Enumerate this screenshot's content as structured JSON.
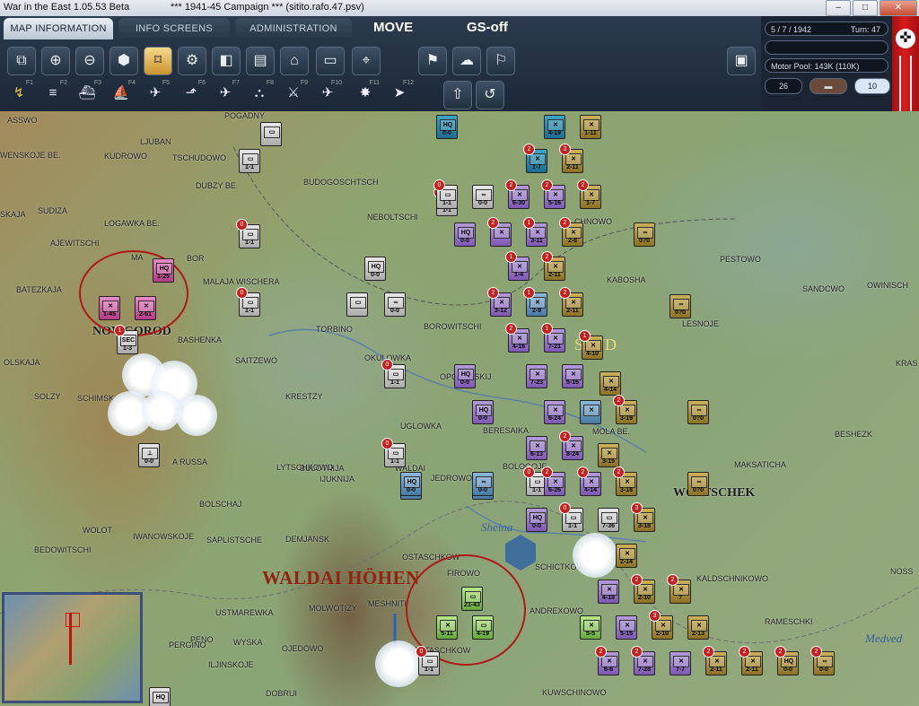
{
  "window": {
    "title": "War in the East 1.05.53 Beta",
    "subtitle": "***   1941-45 Campaign   ***   (sitito.rafo.47.psv)",
    "minimize": "‒",
    "maximize": "□",
    "close": "✕"
  },
  "tabs": [
    {
      "label": "MAP INFORMATION",
      "active": true
    },
    {
      "label": "INFO SCREENS",
      "active": false
    },
    {
      "label": "ADMINISTRATION",
      "active": false
    }
  ],
  "modes": {
    "move": "MOVE",
    "gs": "GS-off"
  },
  "info": {
    "date": "5 / 7 / 1942",
    "turn": "Turn: 47",
    "motor_pool": "Motor Pool:  143K (110K)",
    "count": "26",
    "value": "10"
  },
  "toolbar_row1": [
    {
      "icon": "windows-icon",
      "glyph": "⧉"
    },
    {
      "icon": "zoom-in-icon",
      "glyph": "⊕"
    },
    {
      "icon": "zoom-out-icon",
      "glyph": "⊖"
    },
    {
      "icon": "hex-grid-icon",
      "glyph": "⬢"
    },
    {
      "icon": "unit-frame-icon",
      "glyph": "⌑",
      "selected": true
    },
    {
      "icon": "gear-icon",
      "glyph": "⚙"
    },
    {
      "icon": "unit-display-icon",
      "glyph": "◧"
    },
    {
      "icon": "hq-icon",
      "glyph": "▤"
    },
    {
      "icon": "factory-icon",
      "glyph": "⌂"
    },
    {
      "icon": "rectangle-icon",
      "glyph": "▭"
    },
    {
      "icon": "fortification-icon",
      "glyph": "⌖"
    },
    {
      "icon": "flag-signal-icon",
      "glyph": "⚑"
    },
    {
      "icon": "weather-icon",
      "glyph": "☁"
    },
    {
      "icon": "flag-icon",
      "glyph": "⚐"
    },
    {
      "icon": "panel-icon",
      "glyph": "▣"
    }
  ],
  "toolbar_row2": [
    {
      "icon": "move-mode-icon",
      "glyph": "↯",
      "key": "F1",
      "selected": true
    },
    {
      "icon": "rail-icon",
      "glyph": "≡",
      "key": "F2"
    },
    {
      "icon": "naval-icon",
      "glyph": "⛴",
      "key": "F3"
    },
    {
      "icon": "ship-icon",
      "glyph": "⛵",
      "key": "F4"
    },
    {
      "icon": "air-recon-icon",
      "glyph": "✈",
      "key": "F5"
    },
    {
      "icon": "air-supply-icon",
      "glyph": "⬏",
      "key": "F6"
    },
    {
      "icon": "air-transport-icon",
      "glyph": "✈",
      "key": "F7"
    },
    {
      "icon": "airbase-icon",
      "glyph": "⛬",
      "key": "F8"
    },
    {
      "icon": "paradrop-icon",
      "glyph": "⚔",
      "key": "F9"
    },
    {
      "icon": "air-attack-icon",
      "glyph": "✈",
      "key": "F10"
    },
    {
      "icon": "bombing-icon",
      "glyph": "✸",
      "key": "F11"
    },
    {
      "icon": "compass-icon",
      "glyph": "➤",
      "key": "F12"
    },
    {
      "icon": "upload-icon",
      "glyph": "⇧"
    },
    {
      "icon": "undo-icon",
      "glyph": "↺"
    }
  ],
  "map_labels": [
    {
      "text": "ASSWO"
    },
    {
      "text": "POGADNY"
    },
    {
      "text": "LJUBAN"
    },
    {
      "text": "WENSKOJE BE."
    },
    {
      "text": "KUDROWO"
    },
    {
      "text": "TSCHUDOWO"
    },
    {
      "text": "BUDOGOSCHTSCH"
    },
    {
      "text": "SKAJA"
    },
    {
      "text": "SUDIZA"
    },
    {
      "text": "DUBZY BE"
    },
    {
      "text": "NEBOLTSCHI"
    },
    {
      "text": "CHNOWO"
    },
    {
      "text": "LOGAWKA BE."
    },
    {
      "text": "AJEWITSCHI"
    },
    {
      "text": "MA"
    },
    {
      "text": "BOR"
    },
    {
      "text": "PESTOWO"
    },
    {
      "text": "BATEZKAJA"
    },
    {
      "text": "MALAJA WISCHERA"
    },
    {
      "text": "KABOSHA"
    },
    {
      "text": "SANDCWO"
    },
    {
      "text": "OWINISCH"
    },
    {
      "text": "LESNOJE"
    },
    {
      "text": "NOWGOROD"
    },
    {
      "text": "BASHENKA"
    },
    {
      "text": "TORBINO"
    },
    {
      "text": "BOROWITSCHI"
    },
    {
      "text": "OLSKAJA"
    },
    {
      "text": "SAITZEWO"
    },
    {
      "text": "OKULOWKA"
    },
    {
      "text": "KRAS"
    },
    {
      "text": "SOLZY"
    },
    {
      "text": "SCHIMSK"
    },
    {
      "text": "KRESTZY"
    },
    {
      "text": "OPCHENSKIJ"
    },
    {
      "text": "UGLOWKA"
    },
    {
      "text": "BERESAIKA"
    },
    {
      "text": "MOLA BE."
    },
    {
      "text": "BESHEZK"
    },
    {
      "text": "BULOTNIJA"
    },
    {
      "text": "BOLOGOJE"
    },
    {
      "text": "MAKSATICHA"
    },
    {
      "text": "LYTSCHKOWO"
    },
    {
      "text": "WALDAI"
    },
    {
      "text": "JEDROWO"
    },
    {
      "text": "WOLTSCHEK"
    },
    {
      "text": "A RUSSA"
    },
    {
      "text": "IJUKNIJA"
    },
    {
      "text": "OSTASCHKOW"
    },
    {
      "text": "BOLSCHAJ"
    },
    {
      "text": "WOLOT"
    },
    {
      "text": "IWANOWSKOJE"
    },
    {
      "text": "SAPLISTSCHE"
    },
    {
      "text": "DEMJANSK"
    },
    {
      "text": "SCHICTKOWO"
    },
    {
      "text": "BEDOWITSCHI"
    },
    {
      "text": "FIROWO"
    },
    {
      "text": "KALDSCHNIKOWO"
    },
    {
      "text": "NOSS"
    },
    {
      "text": "MESHNITI"
    },
    {
      "text": "USTMAREWKA"
    },
    {
      "text": "MOLWOTIZY"
    },
    {
      "text": "ANDREXOWO"
    },
    {
      "text": "RAMESCHKI"
    },
    {
      "text": "PENO"
    },
    {
      "text": "WYSKA"
    },
    {
      "text": "OSTASCHKOW"
    },
    {
      "text": "PERGINO"
    },
    {
      "text": "OJEDOWO"
    },
    {
      "text": "ILJINSKOJE"
    },
    {
      "text": "KUWSCHINOWO"
    },
    {
      "text": "DOBRUI"
    }
  ],
  "region_label": "WALDAI HÖHEN",
  "river_label": "Sheina",
  "river_label2": "Medved",
  "faded_label": "SEND",
  "units": [
    {
      "c": "u-pink",
      "s": "HQ",
      "v": "1-25",
      "b": ""
    },
    {
      "c": "u-pink",
      "s": "✕",
      "v": "1-45",
      "b": ""
    },
    {
      "c": "u-pink",
      "s": "✕",
      "v": "2-61",
      "b": ""
    },
    {
      "c": "u-gray",
      "s": "SEC",
      "v": "1-3",
      "b": "1"
    },
    {
      "c": "u-gray",
      "s": "▭",
      "v": "",
      "b": ""
    },
    {
      "c": "u-gray",
      "s": "▭",
      "v": "1-1",
      "b": ""
    },
    {
      "c": "u-gray",
      "s": "▭",
      "v": "1-1",
      "b": "0"
    },
    {
      "c": "u-gray",
      "s": "HQ",
      "v": "0-0",
      "b": ""
    },
    {
      "c": "u-gray",
      "s": "▭",
      "v": "1-1",
      "b": "0"
    },
    {
      "c": "u-gray",
      "s": "▭",
      "v": "",
      "b": ""
    },
    {
      "c": "u-gray",
      "s": "∞",
      "v": "0-0",
      "b": ""
    },
    {
      "c": "u-gray",
      "s": "⊥",
      "v": "0-0",
      "b": ""
    },
    {
      "c": "u-gray",
      "s": "▭",
      "v": "1-1",
      "b": "0"
    },
    {
      "c": "u-gray",
      "s": "▭",
      "v": "1-1",
      "b": "0"
    },
    {
      "c": "u-blue",
      "s": "HQ",
      "v": "0-0",
      "b": ""
    },
    {
      "c": "u-blue",
      "s": "∞",
      "v": "0-0",
      "b": ""
    },
    {
      "c": "u-teal",
      "s": "HQ",
      "v": "0-0",
      "b": ""
    },
    {
      "c": "u-gray",
      "s": "▭",
      "v": "1-1",
      "b": "0"
    },
    {
      "c": "u-purple",
      "s": "HQ",
      "v": "0-0",
      "b": ""
    },
    {
      "c": "u-purple",
      "s": "✕",
      "v": "",
      "b": "2"
    },
    {
      "c": "u-purple",
      "s": "✕",
      "v": "3-11",
      "b": "1"
    },
    {
      "c": "u-gold",
      "s": "✕",
      "v": "2-8",
      "b": "2"
    },
    {
      "c": "u-gold",
      "s": "∞",
      "v": "0?0",
      "b": ""
    },
    {
      "c": "u-purple",
      "s": "✕",
      "v": "1-4",
      "b": "1"
    },
    {
      "c": "u-gold",
      "s": "✕",
      "v": "2-11",
      "b": "2"
    },
    {
      "c": "u-purple",
      "s": "✕",
      "v": "3-12",
      "b": "2"
    },
    {
      "c": "u-blue",
      "s": "✕",
      "v": "2-9",
      "b": "1"
    },
    {
      "c": "u-gold",
      "s": "✕",
      "v": "2-11",
      "b": "2"
    },
    {
      "c": "u-gold",
      "s": "∞",
      "v": "0?0",
      "b": ""
    },
    {
      "c": "u-purple",
      "s": "✕",
      "v": "4-16",
      "b": "2"
    },
    {
      "c": "u-purple",
      "s": "✕",
      "v": "7-21",
      "b": "1"
    },
    {
      "c": "u-gold",
      "s": "✕",
      "v": "4-10",
      "b": "1"
    },
    {
      "c": "u-purple",
      "s": "HQ",
      "v": "0-0",
      "b": ""
    },
    {
      "c": "u-purple",
      "s": "✕",
      "v": "7-23",
      "b": ""
    },
    {
      "c": "u-purple",
      "s": "✕",
      "v": "5-16",
      "b": ""
    },
    {
      "c": "u-gold",
      "s": "✕",
      "v": "4-14",
      "b": ""
    },
    {
      "c": "u-gold",
      "s": "∞",
      "v": "0?0",
      "b": ""
    },
    {
      "c": "u-purple",
      "s": "HQ",
      "v": "0-0",
      "b": ""
    },
    {
      "c": "u-purple",
      "s": "✕",
      "v": "6-24",
      "b": ""
    },
    {
      "c": "u-blue",
      "s": "✕",
      "v": "",
      "b": ""
    },
    {
      "c": "u-gold",
      "s": "✕",
      "v": "3-19",
      "b": "2"
    },
    {
      "c": "u-purple",
      "s": "✕",
      "v": "6-13",
      "b": ""
    },
    {
      "c": "u-purple",
      "s": "✕",
      "v": "8-24",
      "b": "2"
    },
    {
      "c": "u-gold",
      "s": "✕",
      "v": "3-15",
      "b": ""
    },
    {
      "c": "u-gray",
      "s": "▭",
      "v": "1-1",
      "b": "0"
    },
    {
      "c": "u-blue",
      "s": "HQ",
      "v": "0-0",
      "b": ""
    },
    {
      "c": "u-blue",
      "s": "∞",
      "v": "0-0",
      "b": ""
    },
    {
      "c": "u-purple",
      "s": "✕",
      "v": "6-26",
      "b": "2"
    },
    {
      "c": "u-purple",
      "s": "✕",
      "v": "4-14",
      "b": "2"
    },
    {
      "c": "u-gold",
      "s": "✕",
      "v": "3-18",
      "b": "2"
    },
    {
      "c": "u-gold",
      "s": "∞",
      "v": "0?0",
      "b": ""
    },
    {
      "c": "u-purple",
      "s": "HQ",
      "v": "0-0",
      "b": ""
    },
    {
      "c": "u-gray",
      "s": "▭",
      "v": "1-1",
      "b": "0"
    },
    {
      "c": "u-gray",
      "s": "▭",
      "v": "7-36",
      "b": ""
    },
    {
      "c": "u-gold",
      "s": "✕",
      "v": "3-18",
      "b": "3"
    },
    {
      "c": "u-gold",
      "s": "✕",
      "v": "2-14",
      "b": ""
    },
    {
      "c": "u-green",
      "s": "▭",
      "v": "21-43",
      "b": ""
    },
    {
      "c": "u-purple",
      "s": "✕",
      "v": "4-18",
      "b": ""
    },
    {
      "c": "u-gold",
      "s": "✕",
      "v": "2-10",
      "b": "2"
    },
    {
      "c": "u-gold",
      "s": "✕",
      "v": "?",
      "b": "2"
    },
    {
      "c": "u-green",
      "s": "✕",
      "v": "5-11",
      "b": ""
    },
    {
      "c": "u-green",
      "s": "▭",
      "v": "4-19",
      "b": ""
    },
    {
      "c": "u-green",
      "s": "✕",
      "v": "5-5",
      "b": ""
    },
    {
      "c": "u-purple",
      "s": "✕",
      "v": "5-15",
      "b": ""
    },
    {
      "c": "u-gold",
      "s": "✕",
      "v": "2-10",
      "b": "3"
    },
    {
      "c": "u-gold",
      "s": "✕",
      "v": "2-13",
      "b": ""
    },
    {
      "c": "u-gray",
      "s": "▭",
      "v": "1-1",
      "b": "0"
    },
    {
      "c": "u-purple",
      "s": "✕",
      "v": "6-6",
      "b": "2"
    },
    {
      "c": "u-purple",
      "s": "✕",
      "v": "7-28",
      "b": "2"
    },
    {
      "c": "u-purple",
      "s": "✕",
      "v": "7-7",
      "b": ""
    },
    {
      "c": "u-gold",
      "s": "✕",
      "v": "2-11",
      "b": "2"
    },
    {
      "c": "u-gold",
      "s": "✕",
      "v": "2-11",
      "b": "2"
    },
    {
      "c": "u-gold",
      "s": "HQ",
      "v": "0-0",
      "b": "2"
    },
    {
      "c": "u-gold",
      "s": "∞",
      "v": "0-0",
      "b": "2"
    },
    {
      "c": "u-gray",
      "s": "HQ",
      "v": "",
      "b": ""
    },
    {
      "c": "u-teal",
      "s": "✕",
      "v": "4-19",
      "b": ""
    },
    {
      "c": "u-gold",
      "s": "✕",
      "v": "1-11",
      "b": ""
    },
    {
      "c": "u-teal",
      "s": "✕",
      "v": "1-7",
      "b": "2"
    },
    {
      "c": "u-gold",
      "s": "✕",
      "v": "2-11",
      "b": "3"
    },
    {
      "c": "u-purple",
      "s": "✕",
      "v": "6-30",
      "b": "2"
    },
    {
      "c": "u-purple",
      "s": "✕",
      "v": "5-16",
      "b": "2"
    },
    {
      "c": "u-gold",
      "s": "✕",
      "v": "1-7",
      "b": "2"
    },
    {
      "c": "u-gray",
      "s": "▭",
      "v": "1-1",
      "b": "0"
    },
    {
      "c": "u-gray",
      "s": "∞",
      "v": "0-0",
      "b": ""
    }
  ]
}
